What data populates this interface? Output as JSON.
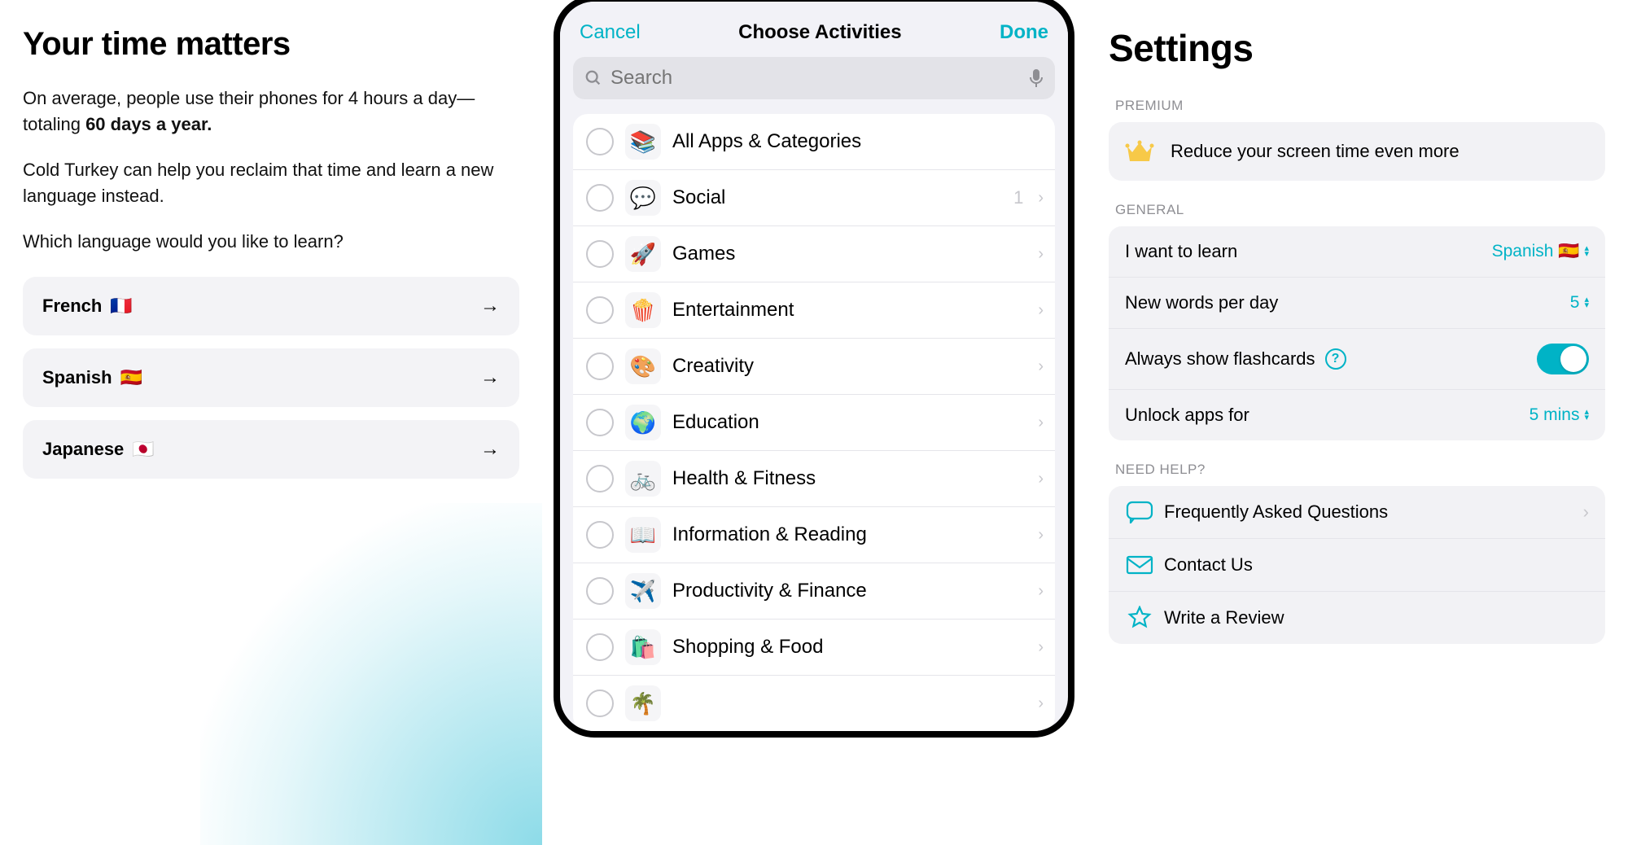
{
  "onboarding": {
    "title": "Your time matters",
    "paragraph1_pre": "On average, people use their phones for 4 hours a day—totaling ",
    "paragraph1_bold": "60 days a year.",
    "paragraph2": "Cold Turkey can help you reclaim that time and learn a new language instead.",
    "paragraph3": "Which language would you like to learn?",
    "languages": [
      {
        "label": "French",
        "flag": "🇫🇷"
      },
      {
        "label": "Spanish",
        "flag": "🇪🇸"
      },
      {
        "label": "Japanese",
        "flag": "🇯🇵"
      }
    ]
  },
  "picker": {
    "cancel": "Cancel",
    "title": "Choose Activities",
    "done": "Done",
    "search_placeholder": "Search",
    "activities": [
      {
        "icon": "📚",
        "label": "All Apps & Categories",
        "count": "",
        "chevron": false,
        "iconbg": "#fff"
      },
      {
        "icon": "💬",
        "label": "Social",
        "count": "1",
        "chevron": true
      },
      {
        "icon": "🚀",
        "label": "Games",
        "count": "",
        "chevron": true
      },
      {
        "icon": "🍿",
        "label": "Entertainment",
        "count": "",
        "chevron": true
      },
      {
        "icon": "🎨",
        "label": "Creativity",
        "count": "",
        "chevron": true
      },
      {
        "icon": "🌍",
        "label": "Education",
        "count": "",
        "chevron": true
      },
      {
        "icon": "🚲",
        "label": "Health & Fitness",
        "count": "",
        "chevron": true
      },
      {
        "icon": "📖",
        "label": "Information & Reading",
        "count": "",
        "chevron": true
      },
      {
        "icon": "✈️",
        "label": "Productivity & Finance",
        "count": "",
        "chevron": true
      },
      {
        "icon": "🛍️",
        "label": "Shopping & Food",
        "count": "",
        "chevron": true
      },
      {
        "icon": "🌴",
        "label": "",
        "count": "",
        "chevron": true
      }
    ]
  },
  "settings": {
    "title": "Settings",
    "premium_header": "PREMIUM",
    "premium_text": "Reduce your screen time even more",
    "general_header": "GENERAL",
    "rows": {
      "learn_label": "I want to learn",
      "learn_value": "Spanish 🇪🇸",
      "words_label": "New words per day",
      "words_value": "5",
      "flashcards_label": "Always show flashcards",
      "unlock_label": "Unlock apps for",
      "unlock_value": "5 mins"
    },
    "help_header": "NEED HELP?",
    "help": {
      "faq": "Frequently Asked Questions",
      "contact": "Contact Us",
      "review": "Write a Review"
    }
  }
}
